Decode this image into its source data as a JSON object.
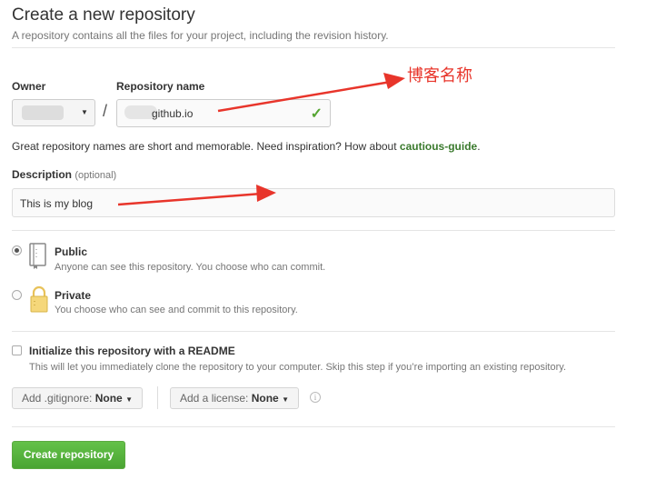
{
  "header": {
    "title": "Create a new repository",
    "subtitle": "A repository contains all the files for your project, including the revision history."
  },
  "owner": {
    "label": "Owner"
  },
  "repository": {
    "label": "Repository name",
    "value": "github.io",
    "separator": "/",
    "hint_prefix": "Great repository names are short and memorable. Need inspiration? How about ",
    "hint_suggestion": "cautious-guide",
    "hint_suffix": "."
  },
  "description": {
    "label": "Description",
    "optional": "(optional)",
    "value": "This is my blog"
  },
  "visibility": {
    "public": {
      "title": "Public",
      "note": "Anyone can see this repository. You choose who can commit.",
      "selected": true
    },
    "private": {
      "title": "Private",
      "note": "You choose who can see and commit to this repository.",
      "selected": false
    }
  },
  "init": {
    "title": "Initialize this repository with a README",
    "note": "This will let you immediately clone the repository to your computer. Skip this step if you’re importing an existing repository.",
    "checked": false
  },
  "gitignore": {
    "label": "Add .gitignore:",
    "value": "None"
  },
  "license": {
    "label": "Add a license:",
    "value": "None"
  },
  "info_icon": "i",
  "create_button": "Create repository",
  "annotation": {
    "text": "博客名称",
    "color": "#e8352b"
  },
  "colors": {
    "accent": "#55a532",
    "annotation": "#e8352b"
  }
}
